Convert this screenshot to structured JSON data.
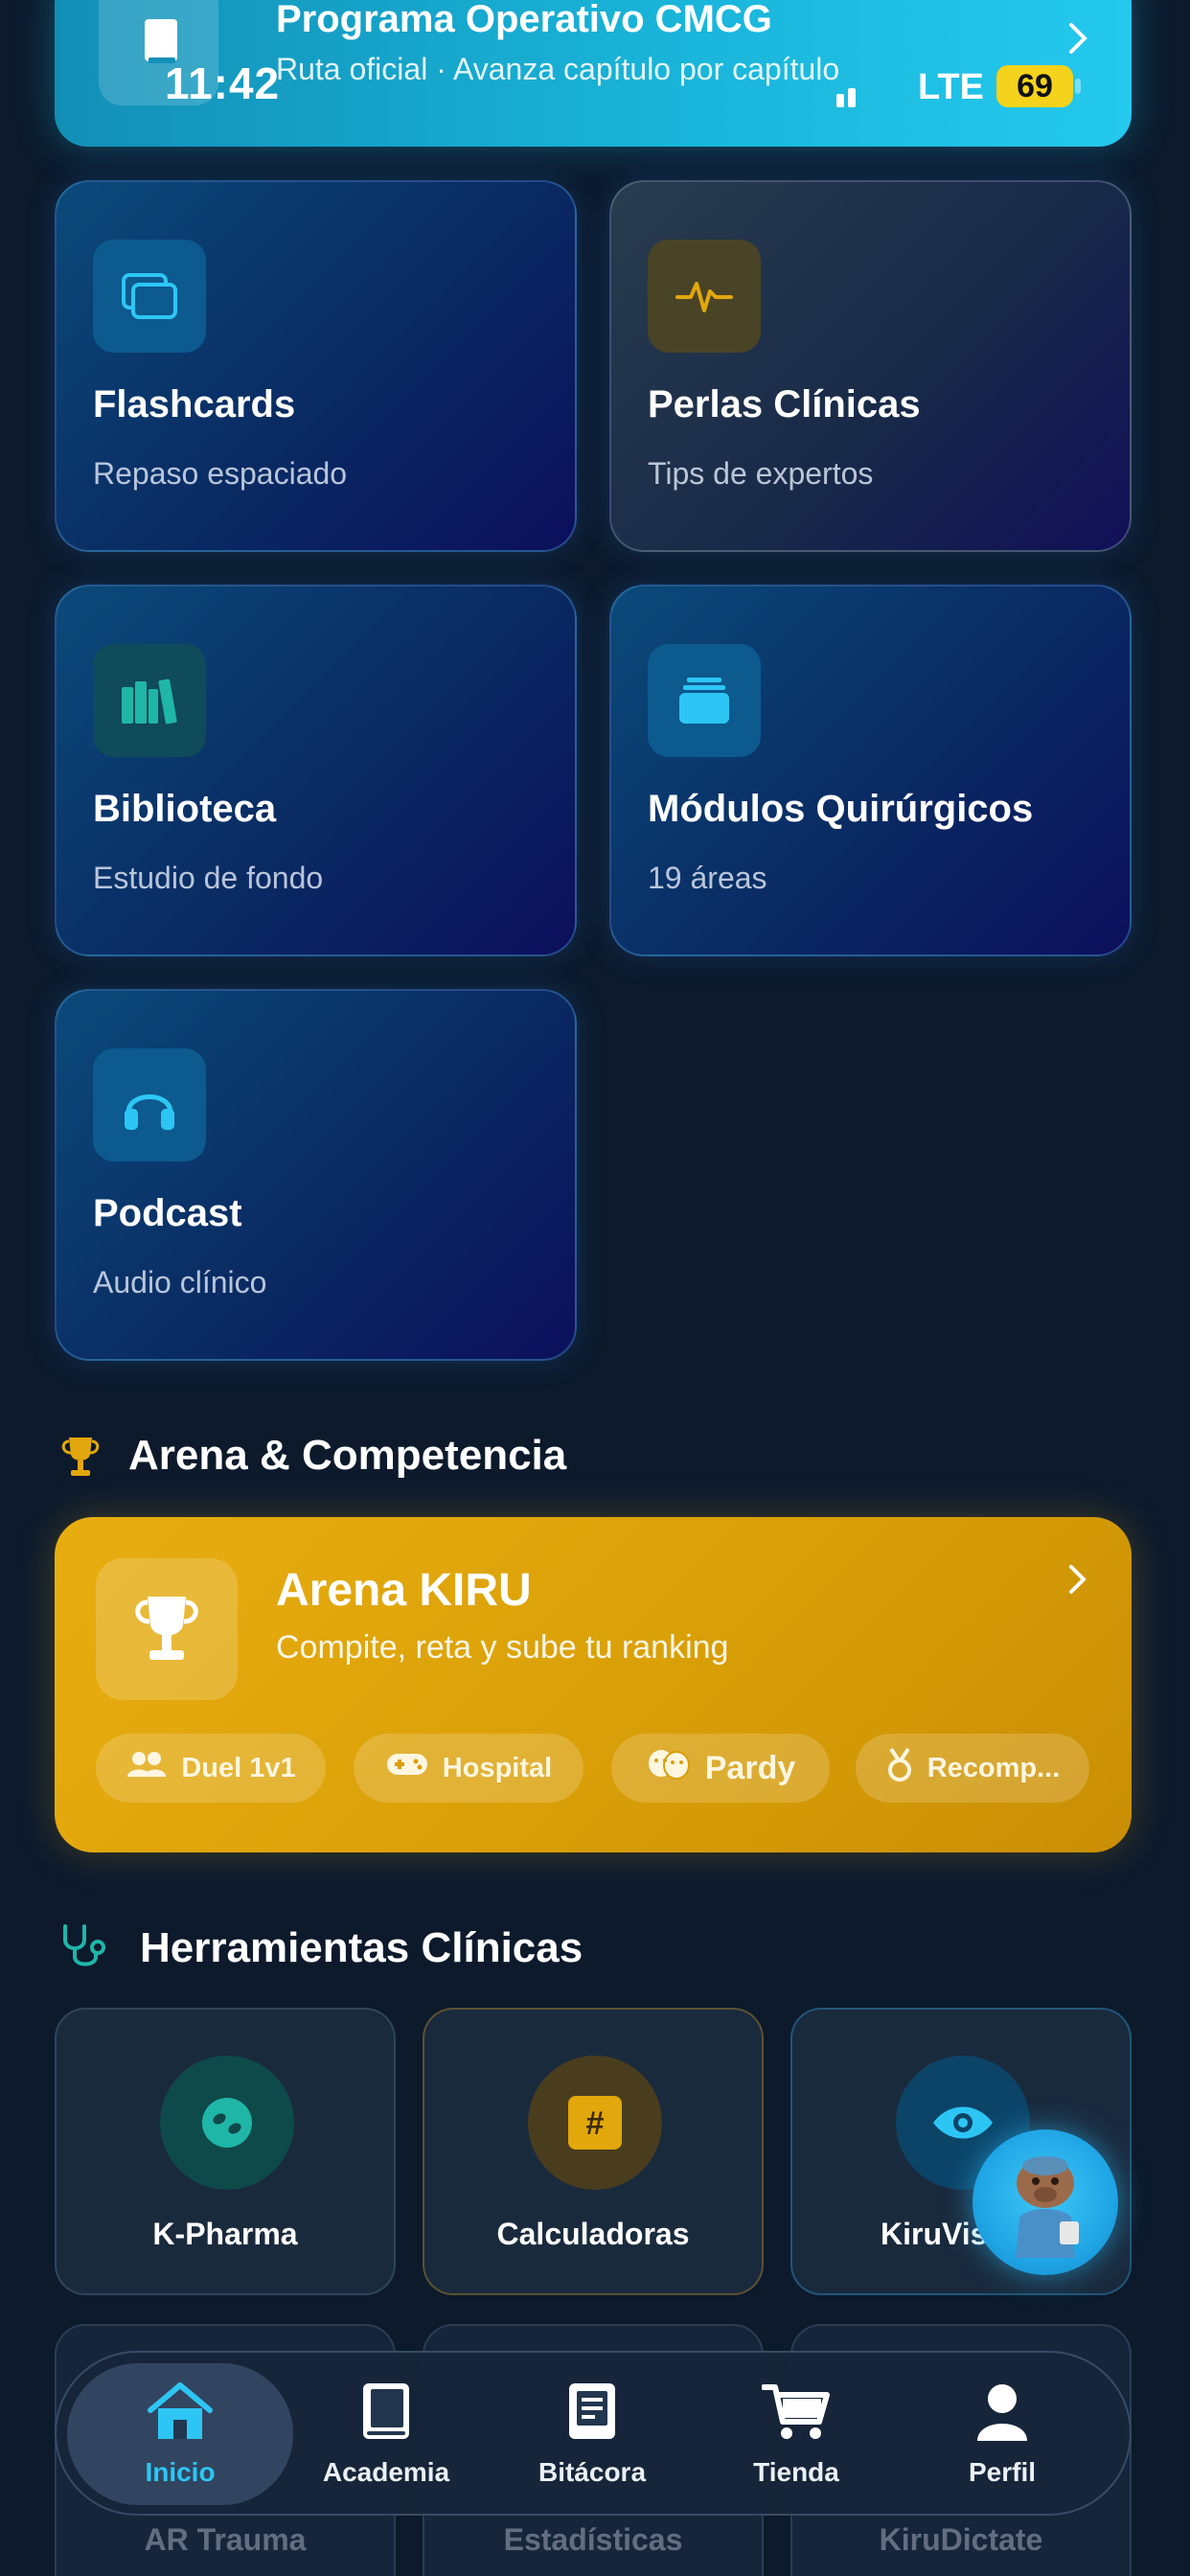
{
  "status_bar": {
    "time": "11:42",
    "network": "LTE",
    "battery": "69"
  },
  "banner": {
    "title": "Programa Operativo CMCG",
    "subtitle": "Ruta oficial · Avanza capítulo por capítulo"
  },
  "cards": [
    {
      "title": "Flashcards",
      "subtitle": "Repaso espaciado",
      "icon": "cards-icon"
    },
    {
      "title": "Perlas Clínicas",
      "subtitle": "Tips de expertos",
      "icon": "pulse-icon"
    },
    {
      "title": "Biblioteca",
      "subtitle": "Estudio de fondo",
      "icon": "books-icon"
    },
    {
      "title": "Módulos Quirúrgicos",
      "subtitle": "19 áreas",
      "icon": "stack-icon"
    },
    {
      "title": "Podcast",
      "subtitle": "Audio clínico",
      "icon": "headphones-icon"
    }
  ],
  "arena_section": {
    "title": "Arena & Competencia"
  },
  "arena": {
    "title": "Arena KIRU",
    "subtitle": "Compite, reta y sube tu ranking",
    "chips": [
      "Duel 1v1",
      "Hospital",
      "Pardy",
      "Recomp..."
    ]
  },
  "tools_section": {
    "title": "Herramientas Clínicas"
  },
  "tools": [
    "K-Pharma",
    "Calculadoras",
    "KiruVis"
  ],
  "tools_row2": [
    "AR Trauma",
    "Estadísticas",
    "KiruDictate"
  ],
  "nav": [
    "Inicio",
    "Academia",
    "Bitácora",
    "Tienda",
    "Perfil"
  ],
  "colors": {
    "accent": "#2dc6f4",
    "arena": "#e2a70c",
    "background": "#0c1a2c"
  }
}
